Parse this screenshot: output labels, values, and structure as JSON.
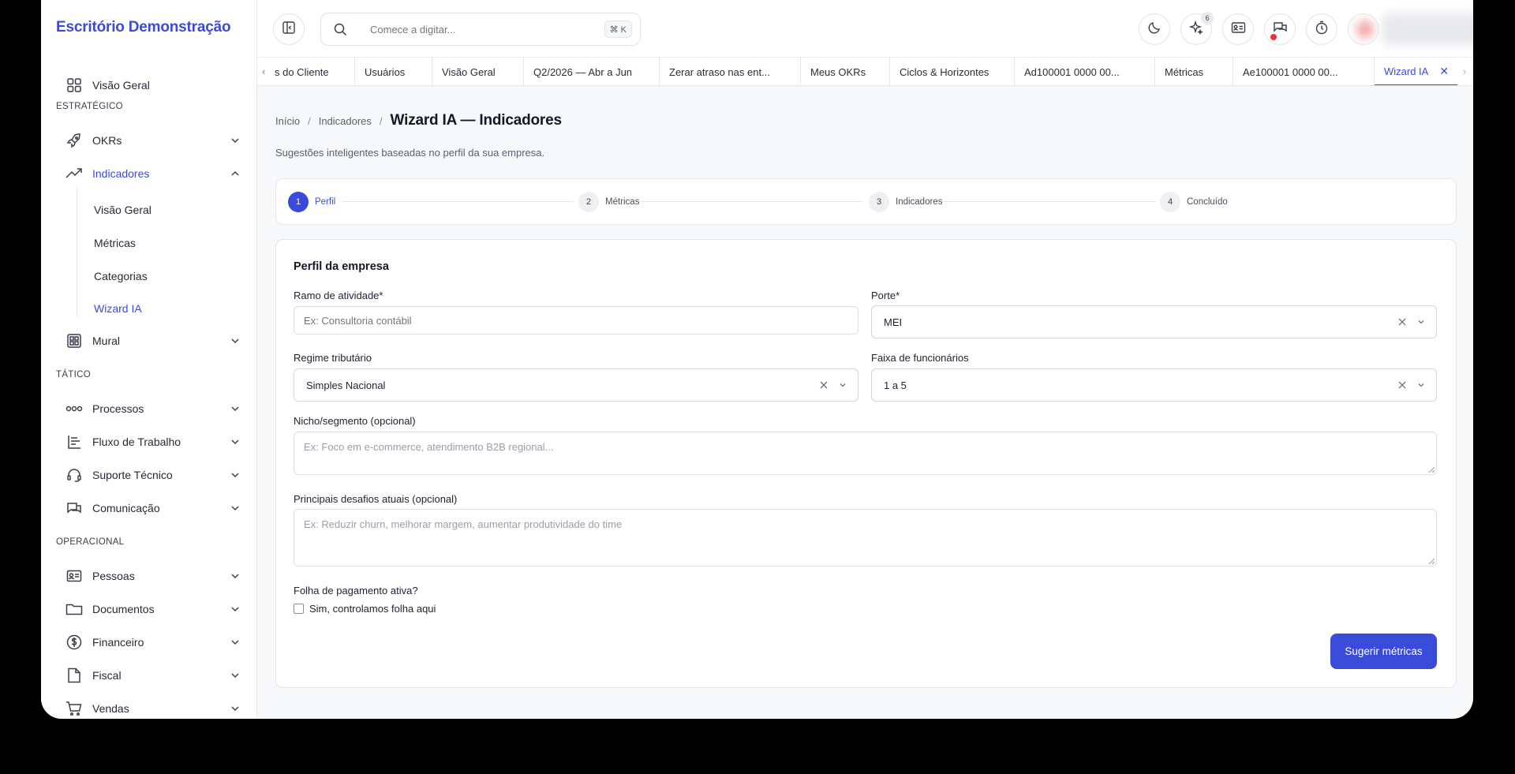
{
  "app": {
    "brand": "Escritório Demonstração"
  },
  "sidebar": {
    "overview": "Visão Geral",
    "sections": [
      "ESTRATÉGICO",
      "TÁTICO",
      "OPERACIONAL"
    ],
    "okrs": "OKRs",
    "indicadores": "Indicadores",
    "indicadores_sub": [
      "Visão Geral",
      "Métricas",
      "Categorias",
      "Wizard IA"
    ],
    "mural": "Mural",
    "processos": "Processos",
    "fluxo": "Fluxo de Trabalho",
    "suporte": "Suporte Técnico",
    "comunicacao": "Comunicação",
    "pessoas": "Pessoas",
    "documentos": "Documentos",
    "financeiro": "Financeiro",
    "fiscal": "Fiscal",
    "vendas": "Vendas"
  },
  "topbar": {
    "search_placeholder": "Comece a digitar...",
    "search_shortcut": "⌘ K",
    "ai_badge": "6"
  },
  "tabs": [
    "s do Cliente",
    "Usuários",
    "Visão Geral",
    "Q2/2026 — Abr a Jun",
    "Zerar atraso nas ent...",
    "Meus OKRs",
    "Ciclos & Horizontes",
    "Ad100001 0000 00...",
    "Métricas",
    "Ae100001 0000 00...",
    "Wizard IA"
  ],
  "page": {
    "breadcrumb": [
      "Início",
      "Indicadores",
      "Wizard IA — Indicadores"
    ],
    "subtitle": "Sugestões inteligentes baseadas no perfil da sua empresa."
  },
  "steps": [
    {
      "num": "1",
      "label": "Perfil"
    },
    {
      "num": "2",
      "label": "Métricas"
    },
    {
      "num": "3",
      "label": "Indicadores"
    },
    {
      "num": "4",
      "label": "Concluído"
    }
  ],
  "form": {
    "title": "Perfil da empresa",
    "ramo_label": "Ramo de atividade*",
    "ramo_placeholder": "Ex: Consultoria contábil",
    "porte_label": "Porte*",
    "porte_value": "MEI",
    "regime_label": "Regime tributário",
    "regime_value": "Simples Nacional",
    "faixa_label": "Faixa de funcionários",
    "faixa_value": "1 a 5",
    "nicho_label": "Nicho/segmento (opcional)",
    "nicho_placeholder": "Ex: Foco em e-commerce, atendimento B2B regional...",
    "desafios_label": "Principais desafios atuais (opcional)",
    "desafios_placeholder": "Ex: Reduzir churn, melhorar margem, aumentar produtividade do time",
    "folha_label": "Folha de pagamento ativa?",
    "folha_checkbox": "Sim, controlamos folha aqui",
    "submit": "Sugerir métricas"
  },
  "colors": {
    "accent": "#3b4bd9",
    "background": "#f7f8fa"
  }
}
